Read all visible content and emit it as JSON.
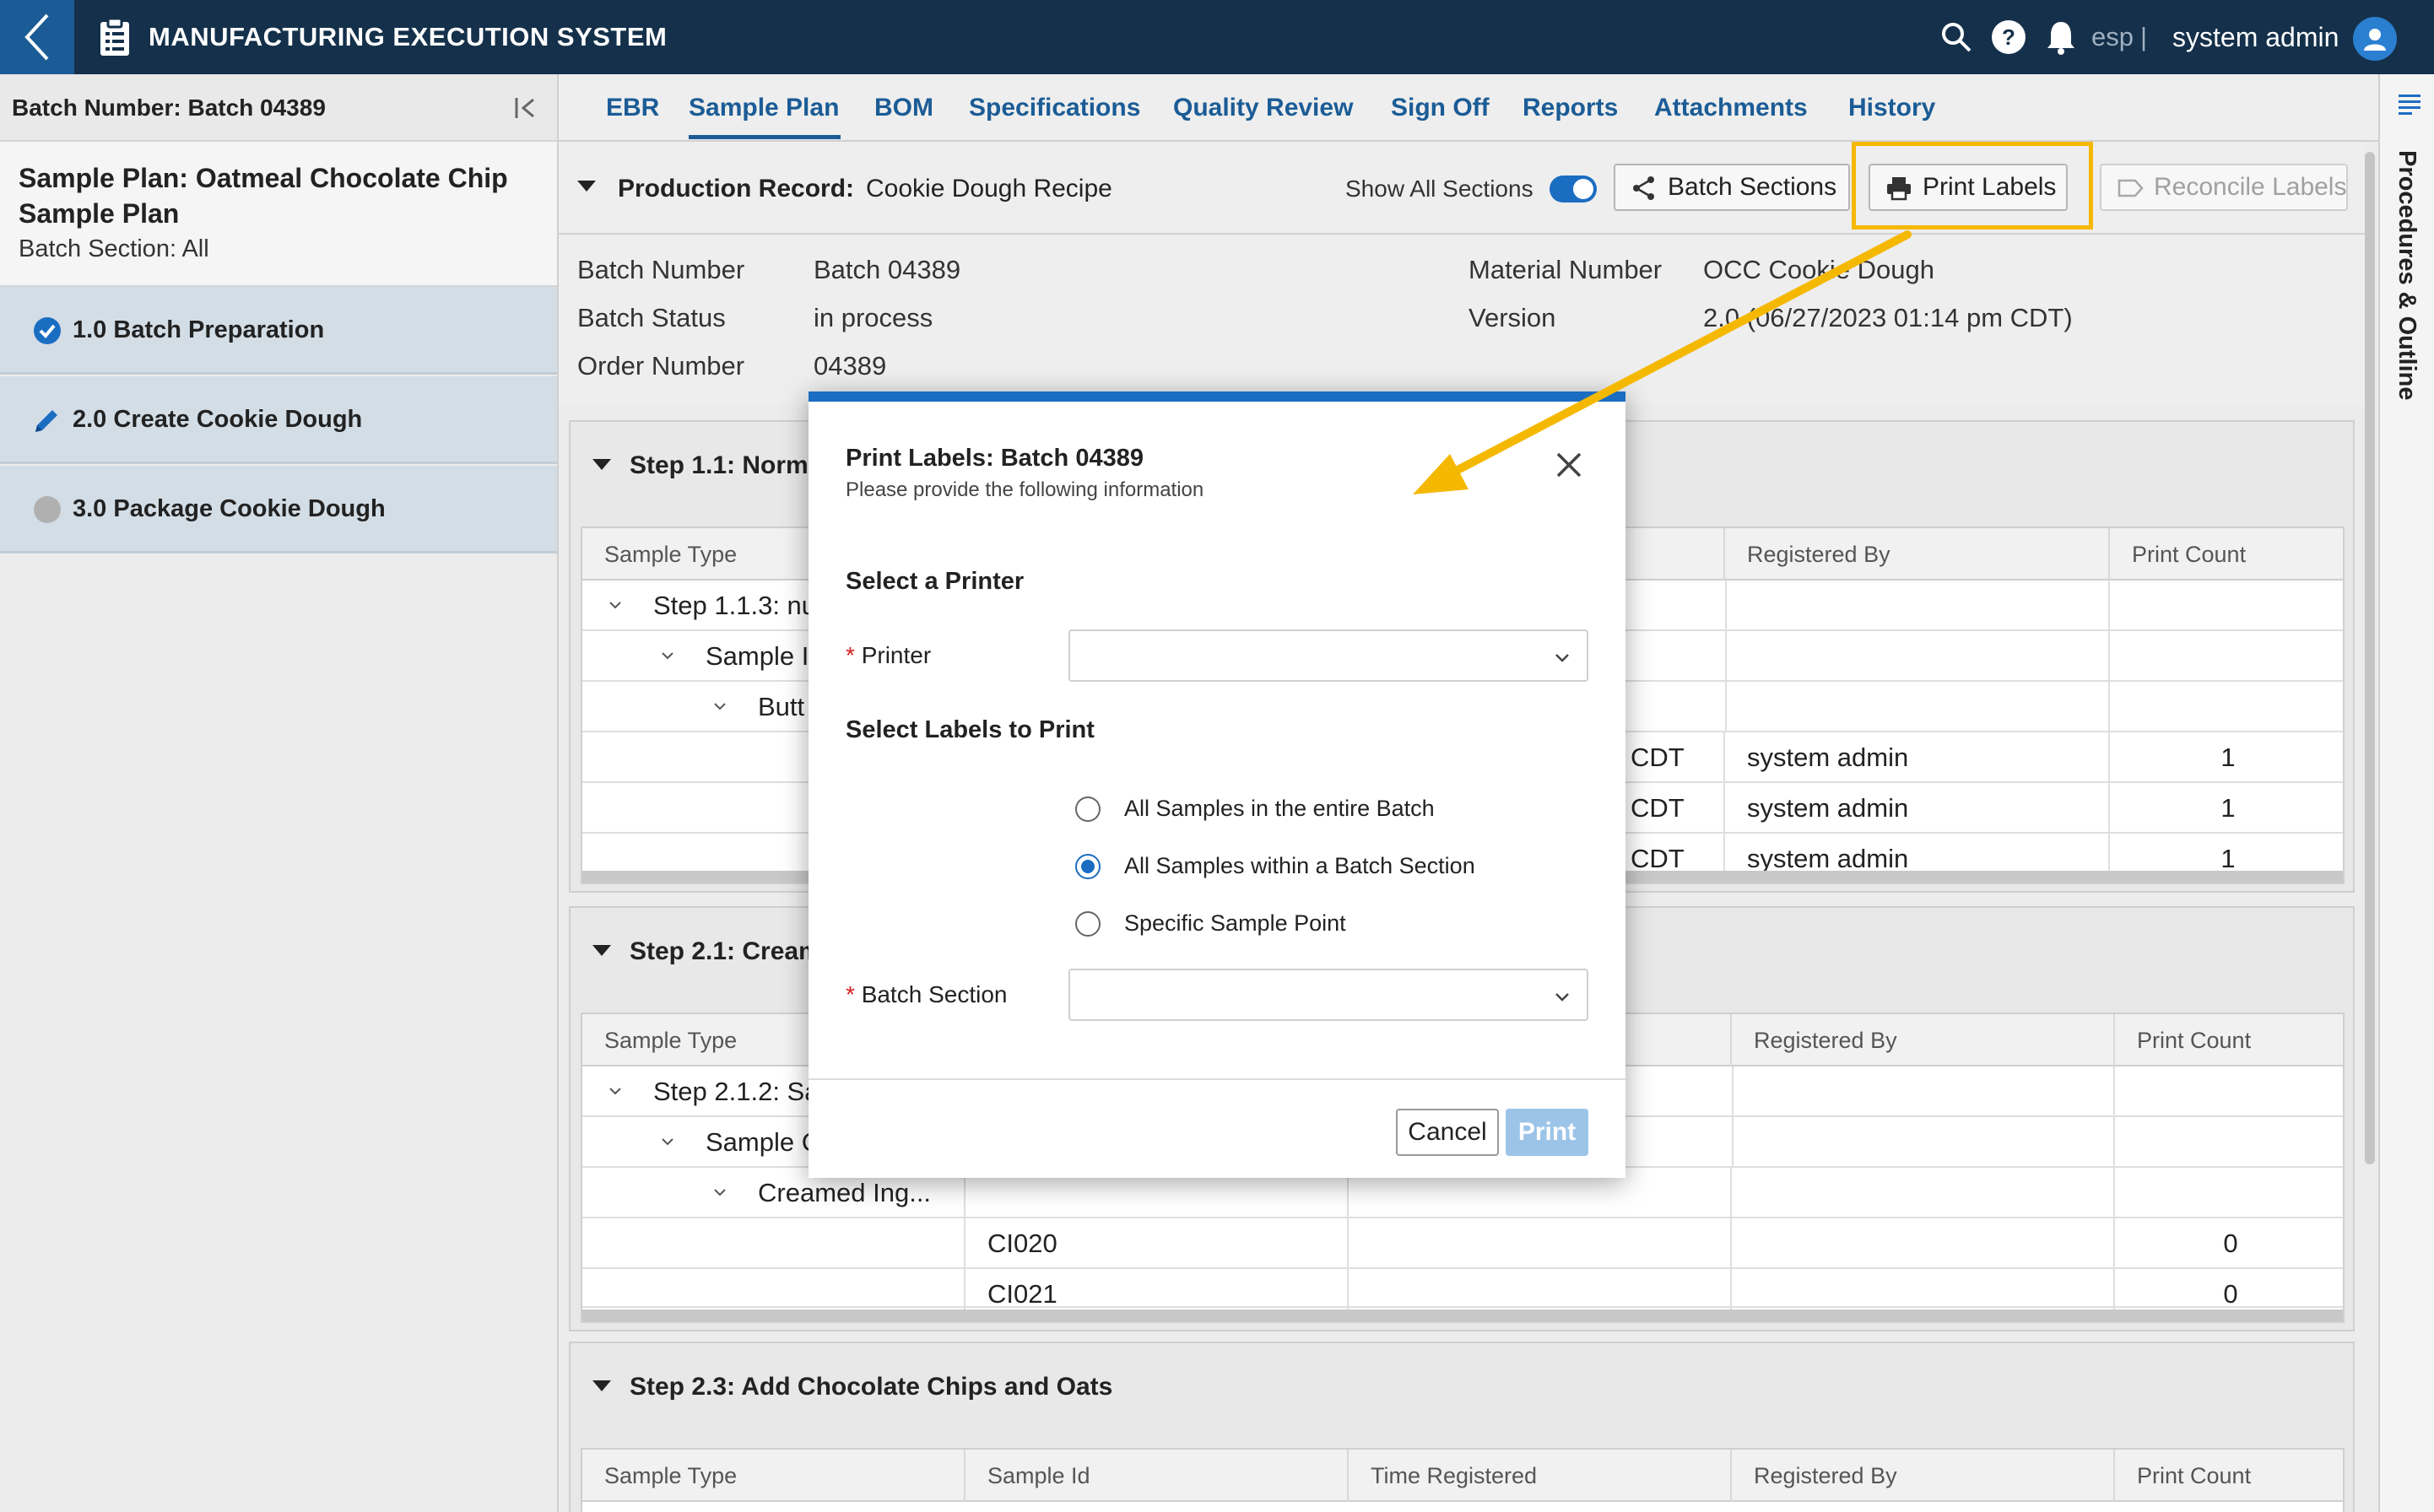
{
  "app": {
    "title": "MANUFACTURING EXECUTION SYSTEM",
    "lang": "esp",
    "lang_sep": "|",
    "user": "system admin"
  },
  "left": {
    "batch_number": "Batch Number: Batch 04389",
    "plan_title": "Sample Plan: Oatmeal Chocolate Chip Sample Plan",
    "plan_section": "Batch Section: All",
    "items": [
      {
        "label": "1.0 Batch Preparation",
        "icon": "check-circle-icon",
        "color": "#1b6dc1"
      },
      {
        "label": "2.0 Create Cookie Dough",
        "icon": "pencil-icon",
        "color": "#1b6dc1"
      },
      {
        "label": "3.0 Package Cookie Dough",
        "icon": "pending-circle-icon",
        "color": "#b0b0b0"
      }
    ]
  },
  "tabs": [
    "EBR",
    "Sample Plan",
    "BOM",
    "Specifications",
    "Quality Review",
    "Sign Off",
    "Reports",
    "Attachments",
    "History"
  ],
  "active_tab": "Sample Plan",
  "outline_label": "Procedures & Outline",
  "record": {
    "label": "Production Record:",
    "value": "Cookie Dough Recipe",
    "show_all_label": "Show All Sections",
    "show_all_on": true,
    "batch_sections_btn": "Batch Sections",
    "print_labels_btn": "Print Labels",
    "reconcile_labels_btn": "Reconcile Labels"
  },
  "info": {
    "batch_number_label": "Batch Number",
    "batch_number": "Batch 04389",
    "batch_status_label": "Batch Status",
    "batch_status": "in process",
    "order_number_label": "Order Number",
    "order_number": "04389",
    "material_number_label": "Material Number",
    "material_number": "OCC Cookie Dough",
    "version_label": "Version",
    "version": "2.0 (06/27/2023 01:14 pm CDT)"
  },
  "columns": [
    "Sample Type",
    "Sample Id",
    "Time Registered",
    "Registered By",
    "Print Count"
  ],
  "steps": [
    {
      "title": "Step 1.1: Normal",
      "tree": [
        "Step 1.1.3: nu",
        "Sample I",
        "Butt"
      ],
      "rows": [
        {
          "time": "CDT",
          "by": "system admin",
          "count": "1"
        },
        {
          "time": "CDT",
          "by": "system admin",
          "count": "1"
        },
        {
          "time": "CDT",
          "by": "system admin",
          "count": "1"
        }
      ]
    },
    {
      "title": "Step 2.1: Cream",
      "tree": [
        "Step 2.1.2: Sa",
        "Sample C",
        "Creamed Ing..."
      ],
      "rows": [
        {
          "id": "CI020",
          "count": "0"
        },
        {
          "id": "CI021",
          "count": "0"
        }
      ]
    },
    {
      "title": "Step 2.3: Add Chocolate Chips and Oats"
    }
  ],
  "modal": {
    "title": "Print Labels: Batch 04389",
    "subtitle": "Please provide the following information",
    "sec_printer": "Select a Printer",
    "printer_label": "Printer",
    "printer_value": "",
    "sec_labels": "Select Labels to Print",
    "options": [
      "All Samples in the entire Batch",
      "All Samples within a Batch Section",
      "Specific Sample Point"
    ],
    "selected_option": 1,
    "batch_section_label": "Batch Section",
    "batch_section_value": "",
    "required_mark": "*",
    "cancel": "Cancel",
    "print": "Print"
  },
  "colors": {
    "topbar": "#14304a",
    "accent": "#1b6dc1",
    "highlight": "#f5b800",
    "required": "#d42020"
  }
}
